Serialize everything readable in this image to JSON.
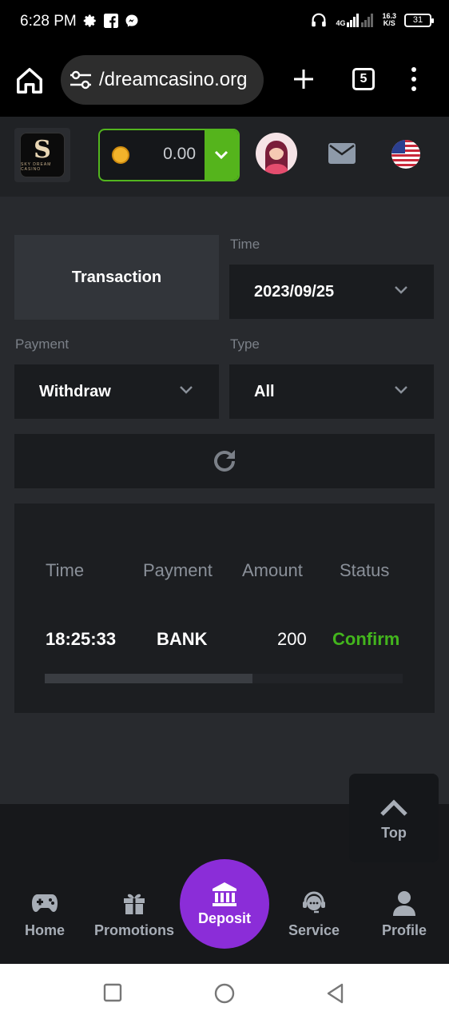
{
  "status_bar": {
    "time": "6:28 PM",
    "network_type": "4G",
    "speed_value": "16.3",
    "speed_unit": "K/S",
    "battery": "31"
  },
  "browser": {
    "url": "/dreamcasino.org",
    "tab_count": "5"
  },
  "header": {
    "logo_letter": "S",
    "logo_text": "SKY DREAM CASINO",
    "balance": "0.00"
  },
  "filters": {
    "transaction_tab": "Transaction",
    "time_label": "Time",
    "time_value": "2023/09/25",
    "payment_label": "Payment",
    "payment_value": "Withdraw",
    "type_label": "Type",
    "type_value": "All"
  },
  "table": {
    "headers": [
      "Time",
      "Payment",
      "Amount",
      "Status"
    ],
    "rows": [
      {
        "time": "18:25:33",
        "payment": "BANK",
        "amount": "200",
        "status": "Confirm"
      }
    ],
    "scroll_position": 0.58
  },
  "top_button": {
    "label": "Top"
  },
  "bottom_nav": {
    "home": "Home",
    "promotions": "Promotions",
    "deposit": "Deposit",
    "service": "Service",
    "profile": "Profile"
  },
  "colors": {
    "accent_green": "#55b41c",
    "status_confirm": "#43b51d",
    "deposit_purple": "#8b2dd8",
    "background": "#282a2e"
  }
}
